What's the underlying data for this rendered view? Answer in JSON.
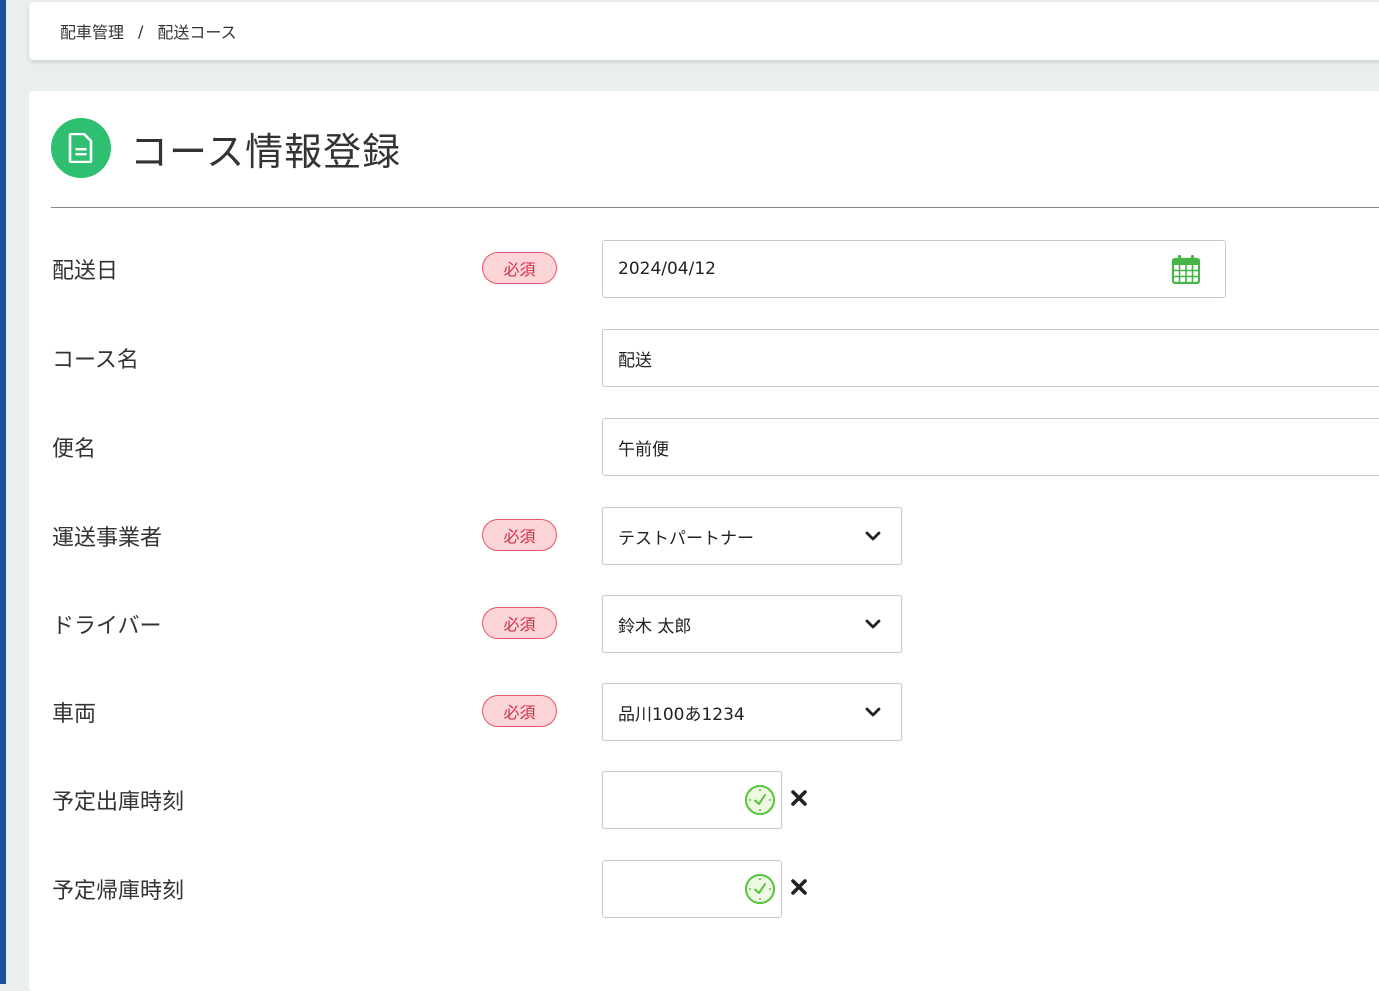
{
  "breadcrumb": {
    "parent": "配車管理",
    "separator": "/",
    "current": "配送コース"
  },
  "page": {
    "title": "コース情報登録",
    "icon": "document-icon"
  },
  "colors": {
    "accent_green": "#2fbf71",
    "required_text": "#d22f48",
    "required_bg": "#fbd5d8",
    "left_rail": "#1d4fa1"
  },
  "form": {
    "required_label": "必須",
    "fields": {
      "delivery_date": {
        "label": "配送日",
        "value": "2024/04/12"
      },
      "course_name": {
        "label": "コース名",
        "value": "配送"
      },
      "flight_name": {
        "label": "便名",
        "value": "午前便"
      },
      "carrier": {
        "label": "運送事業者",
        "value": "テストパートナー"
      },
      "driver": {
        "label": "ドライバー",
        "value": "鈴木 太郎"
      },
      "vehicle": {
        "label": "車両",
        "value": "品川100あ1234"
      },
      "departure_time": {
        "label": "予定出庫時刻",
        "value": ""
      },
      "return_time": {
        "label": "予定帰庫時刻",
        "value": ""
      }
    }
  }
}
